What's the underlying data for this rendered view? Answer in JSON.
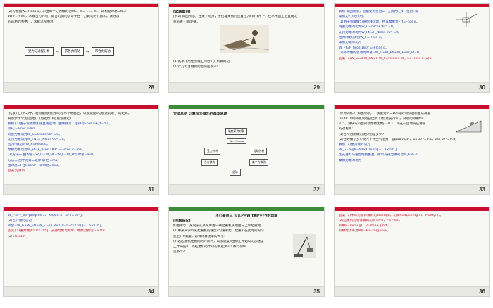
{
  "slides": [
    {
      "number": "28",
      "lines": [
        "(2)先根据W=Flcos α，求出每个分力做的功W₁、W₂、…、Wₙ，再根据W总=W₁+",
        "W₂+…+Wₙ，求解合力的功，即合力做的功等于各个力做功的代数和。该方法",
        "的适用范围更广，求解流程图为:"
      ],
      "flow": [
        "受力与过程分析",
        "求各力的功",
        "求合力的功"
      ]
    },
    {
      "number": "29",
      "lines": [
        "[试题案例]",
        "[例2] 如图所示，在某个地方，手拉着某物的位置拉力F的作用下，在水平面上沿直线匀",
        "速前进了l的距离。",
        "(1)试求作用在雪橇上的各个力所做的功;",
        "(2)外力对雪橇做的总功是多少?"
      ]
    },
    {
      "number": "30",
      "lines": [
        "解析  如图所示，雪橇受到重力G、支持力F_N、拉力F和",
        "摩擦力F_f的作用。",
        "(1)由于雪橇做匀速直线运动，所以摩擦力F_f=Fcos α。",
        "则重力做的功为W_G=Glcos 90° =0。",
        "支持力做的功为W_FN=F_Nlcos 90° =0。",
        "拉力F做的功为W_F=Flcos α。",
        "摩擦力做的功为",
        "W_Ff=F_flcos 180° =-Flcos α。",
        "(2)外力做的总功为W总=W_G+W_FN+W_F+W_Ff=0。",
        "答案  (1)W_G=0  W_FN=0  W_F=Flcos α  W_Ff=-Flcos α  (2)0"
      ]
    },
    {
      "number": "31",
      "lines": [
        "[拓展] 在(例2)中，若雪橇(质量为m)在水平地面上，以加速度a匀加速前进了l的距离，",
        "其余条件不变(图略)，(假设所作过程都满足)",
        "解析  (1)由于雪橇做加速直线运动，由牛顿第二定律得Fcos α-F_f=ma。",
        "得F_f=Fcos α-ma",
        "则重力做功为W_G=Glcos 90° =0。",
        "支持力做功为W_FN=F_Nlcos 90° =0。",
        "拉力F做功为W_F=Flcos α。",
        "摩擦力做功为W_Ff=F_flcos 180° =-Flcos α+mal。",
        "(2)方法一  由W总=W_G+W_FN+W_F+W_Ff得W总=mal。",
        "方法二  由牛顿第二定律得F合=ma。",
        "由W总=F合lcos 0°，得W总=mal。",
        "答案  见解析"
      ]
    },
    {
      "number": "32",
      "title": "方法总结  计算恒力做功的基本思路",
      "tree": [
        "确定研究对象",
        "W=Flcos α",
        "受力分析",
        "运动分析",
        "合力做功",
        "某个力做功",
        "总功"
      ]
    },
    {
      "number": "33",
      "lines": [
        "[针对训练2] 如图所示，一质量为m=10 kg的滑块沿斜面从高度",
        "h=30 m的斜坡顶端自由滑下(初速度为零)。斜坡的倾角θ=",
        "37°，滑块与斜面间动摩擦因数μ=0.1。则这一运动员在滑雪",
        "的过程中:",
        "(1)各个力所做的功分别是多少?",
        "(2)合力做了多少功?(不计空气阻力，g取10 m/s²，sin 37°=0.6，cos 37°=0.8)",
        "解析  (1)重力做的功为",
        "W_G=mgh=60×10×30 J=1.8×10⁴ J",
        "因支持力与速度始终垂直，所以支持力做的功W_FN=0",
        "摩擦力做的功为"
      ]
    },
    {
      "number": "34",
      "lines": [
        "W_Ff=-F_fl=-μmgcos 37°×h/sin 37°=-2×10³ J。",
        "(2)合力做的功为",
        "W合=W_G+W_FN+W_Ff=(1.8×10⁴+0-2×10³) J=1.6×10⁴ J。",
        "答案  (1)重力做功1.8×10⁴ J，支持力做功为零，摩擦力做功-2×10³ J",
        "(2)1.6×10⁴ J"
      ]
    },
    {
      "number": "35",
      "title": "核心要点三  公式P=W/t和P=Fv的理解",
      "lines": [
        "[问题探究]",
        "如图所示，某同学从某车库用一辆起重机从地面向上吊起重物。",
        "(1)甲某同学以某起重机的速度v匀速吊起，起重机在此时间内匀",
        "速上升h高度，怎样计算功率的大小?",
        "(2)若起重机在相同的时间内，以加速度a由静止开始以匀加速度",
        "上升高度h，则起重机的平均功率是多少? 瞬时功率",
        "是多少?"
      ]
    },
    {
      "number": "36",
      "lines": [
        "答案  (1)吊车对物体做的功W=mgh，功率P=W/t=mgh/t，P=mgh/t。",
        "(2)起重机对物体做的功W=F·h，P=F·h/t，",
        "其中F=m(a+g)，P=m(a+g)h/t。",
        "其瞬时功率为P瞬=Fv=m(g+a)v。"
      ]
    }
  ],
  "colors": {
    "accent": "#c8102e",
    "blue": "#1f3fb6",
    "green_bar": "#3c8c3c"
  }
}
